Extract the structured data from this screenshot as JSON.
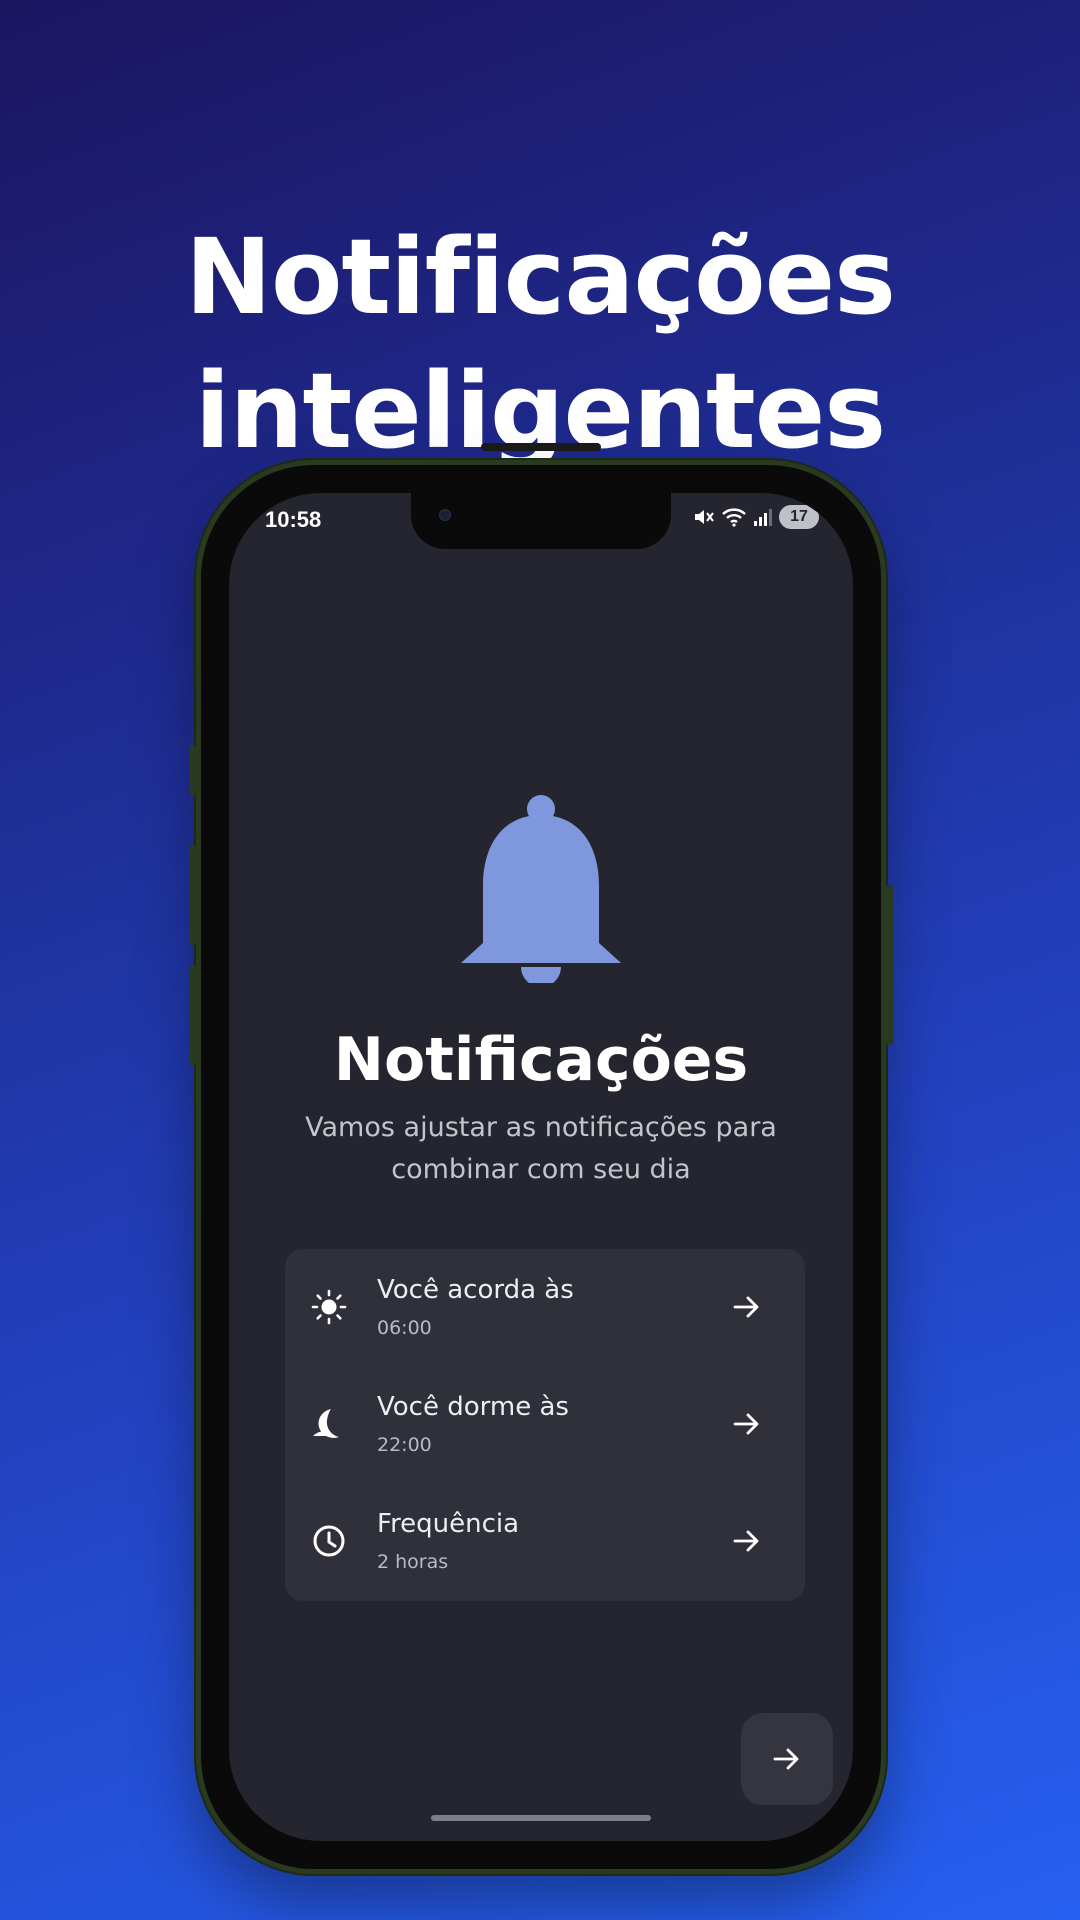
{
  "promo": {
    "headline_line1": "Notificações",
    "headline_line2": "inteligentes"
  },
  "status_bar": {
    "time": "10:58",
    "battery": "17",
    "icons": [
      "mute-icon",
      "wifi-icon",
      "signal-icon"
    ]
  },
  "screen": {
    "title": "Notificações",
    "subtitle": "Vamos ajustar as notificações para combinar com seu dia",
    "icon": "bell-icon",
    "accent_color": "#7f97dc",
    "settings": [
      {
        "label": "Você acorda às",
        "value": "06:00",
        "icon": "sun-icon"
      },
      {
        "label": "Você dorme às",
        "value": "22:00",
        "icon": "moon-icon"
      },
      {
        "label": "Frequência",
        "value": "2 horas",
        "icon": "clock-icon"
      }
    ],
    "next_button_icon": "arrow-right-icon"
  },
  "colors": {
    "background_start": "#1c1560",
    "background_end": "#2660f0",
    "screen_background": "#24252f",
    "card_background": "#2f3039"
  }
}
